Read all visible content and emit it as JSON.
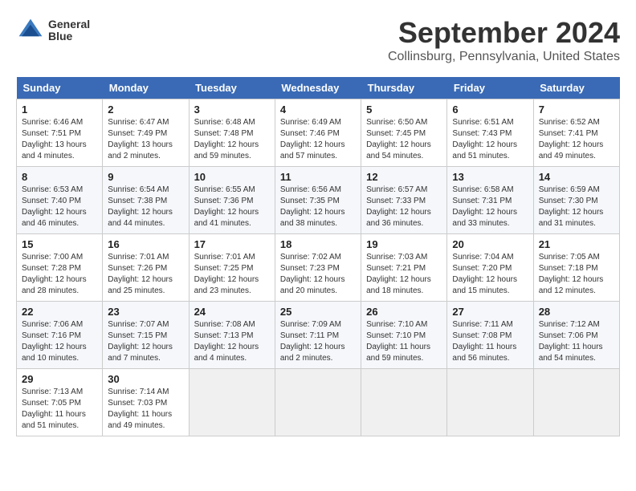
{
  "header": {
    "logo_line1": "General",
    "logo_line2": "Blue",
    "title": "September 2024",
    "subtitle": "Collinsburg, Pennsylvania, United States"
  },
  "days_of_week": [
    "Sunday",
    "Monday",
    "Tuesday",
    "Wednesday",
    "Thursday",
    "Friday",
    "Saturday"
  ],
  "weeks": [
    [
      {
        "day": "1",
        "sunrise": "6:46 AM",
        "sunset": "7:51 PM",
        "daylight": "13 hours and 4 minutes."
      },
      {
        "day": "2",
        "sunrise": "6:47 AM",
        "sunset": "7:49 PM",
        "daylight": "13 hours and 2 minutes."
      },
      {
        "day": "3",
        "sunrise": "6:48 AM",
        "sunset": "7:48 PM",
        "daylight": "12 hours and 59 minutes."
      },
      {
        "day": "4",
        "sunrise": "6:49 AM",
        "sunset": "7:46 PM",
        "daylight": "12 hours and 57 minutes."
      },
      {
        "day": "5",
        "sunrise": "6:50 AM",
        "sunset": "7:45 PM",
        "daylight": "12 hours and 54 minutes."
      },
      {
        "day": "6",
        "sunrise": "6:51 AM",
        "sunset": "7:43 PM",
        "daylight": "12 hours and 51 minutes."
      },
      {
        "day": "7",
        "sunrise": "6:52 AM",
        "sunset": "7:41 PM",
        "daylight": "12 hours and 49 minutes."
      }
    ],
    [
      {
        "day": "8",
        "sunrise": "6:53 AM",
        "sunset": "7:40 PM",
        "daylight": "12 hours and 46 minutes."
      },
      {
        "day": "9",
        "sunrise": "6:54 AM",
        "sunset": "7:38 PM",
        "daylight": "12 hours and 44 minutes."
      },
      {
        "day": "10",
        "sunrise": "6:55 AM",
        "sunset": "7:36 PM",
        "daylight": "12 hours and 41 minutes."
      },
      {
        "day": "11",
        "sunrise": "6:56 AM",
        "sunset": "7:35 PM",
        "daylight": "12 hours and 38 minutes."
      },
      {
        "day": "12",
        "sunrise": "6:57 AM",
        "sunset": "7:33 PM",
        "daylight": "12 hours and 36 minutes."
      },
      {
        "day": "13",
        "sunrise": "6:58 AM",
        "sunset": "7:31 PM",
        "daylight": "12 hours and 33 minutes."
      },
      {
        "day": "14",
        "sunrise": "6:59 AM",
        "sunset": "7:30 PM",
        "daylight": "12 hours and 31 minutes."
      }
    ],
    [
      {
        "day": "15",
        "sunrise": "7:00 AM",
        "sunset": "7:28 PM",
        "daylight": "12 hours and 28 minutes."
      },
      {
        "day": "16",
        "sunrise": "7:01 AM",
        "sunset": "7:26 PM",
        "daylight": "12 hours and 25 minutes."
      },
      {
        "day": "17",
        "sunrise": "7:01 AM",
        "sunset": "7:25 PM",
        "daylight": "12 hours and 23 minutes."
      },
      {
        "day": "18",
        "sunrise": "7:02 AM",
        "sunset": "7:23 PM",
        "daylight": "12 hours and 20 minutes."
      },
      {
        "day": "19",
        "sunrise": "7:03 AM",
        "sunset": "7:21 PM",
        "daylight": "12 hours and 18 minutes."
      },
      {
        "day": "20",
        "sunrise": "7:04 AM",
        "sunset": "7:20 PM",
        "daylight": "12 hours and 15 minutes."
      },
      {
        "day": "21",
        "sunrise": "7:05 AM",
        "sunset": "7:18 PM",
        "daylight": "12 hours and 12 minutes."
      }
    ],
    [
      {
        "day": "22",
        "sunrise": "7:06 AM",
        "sunset": "7:16 PM",
        "daylight": "12 hours and 10 minutes."
      },
      {
        "day": "23",
        "sunrise": "7:07 AM",
        "sunset": "7:15 PM",
        "daylight": "12 hours and 7 minutes."
      },
      {
        "day": "24",
        "sunrise": "7:08 AM",
        "sunset": "7:13 PM",
        "daylight": "12 hours and 4 minutes."
      },
      {
        "day": "25",
        "sunrise": "7:09 AM",
        "sunset": "7:11 PM",
        "daylight": "12 hours and 2 minutes."
      },
      {
        "day": "26",
        "sunrise": "7:10 AM",
        "sunset": "7:10 PM",
        "daylight": "11 hours and 59 minutes."
      },
      {
        "day": "27",
        "sunrise": "7:11 AM",
        "sunset": "7:08 PM",
        "daylight": "11 hours and 56 minutes."
      },
      {
        "day": "28",
        "sunrise": "7:12 AM",
        "sunset": "7:06 PM",
        "daylight": "11 hours and 54 minutes."
      }
    ],
    [
      {
        "day": "29",
        "sunrise": "7:13 AM",
        "sunset": "7:05 PM",
        "daylight": "11 hours and 51 minutes."
      },
      {
        "day": "30",
        "sunrise": "7:14 AM",
        "sunset": "7:03 PM",
        "daylight": "11 hours and 49 minutes."
      },
      null,
      null,
      null,
      null,
      null
    ]
  ],
  "labels": {
    "sunrise_prefix": "Sunrise: ",
    "sunset_prefix": "Sunset: ",
    "daylight_prefix": "Daylight: "
  }
}
